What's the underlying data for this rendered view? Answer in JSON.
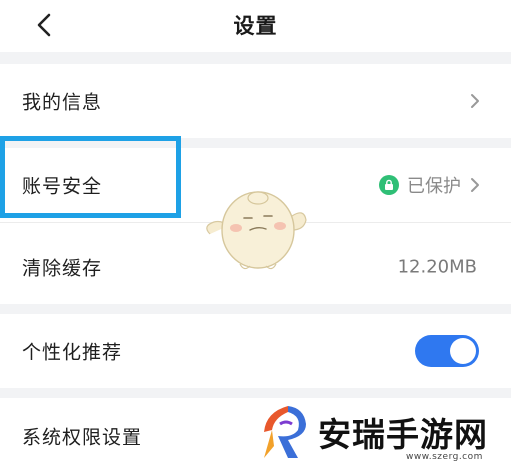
{
  "header": {
    "title": "设置",
    "back_icon": "chevron-left-icon"
  },
  "rows": [
    {
      "label": "我的信息",
      "icon": "chevron-right-icon"
    },
    {
      "label": "账号安全",
      "status": "已保护",
      "status_icon": "lock-icon",
      "icon": "chevron-right-icon"
    },
    {
      "label": "清除缓存",
      "value": "12.20MB"
    },
    {
      "label": "个性化推荐",
      "toggle_on": true
    },
    {
      "label": "系统权限设置"
    }
  ],
  "colors": {
    "toggle": "#2f78f0",
    "highlight": "#1ea1e6",
    "lock": "#2fbf76"
  },
  "watermark": {
    "text": "安瑞手游网",
    "url": "www.szerg.com"
  }
}
